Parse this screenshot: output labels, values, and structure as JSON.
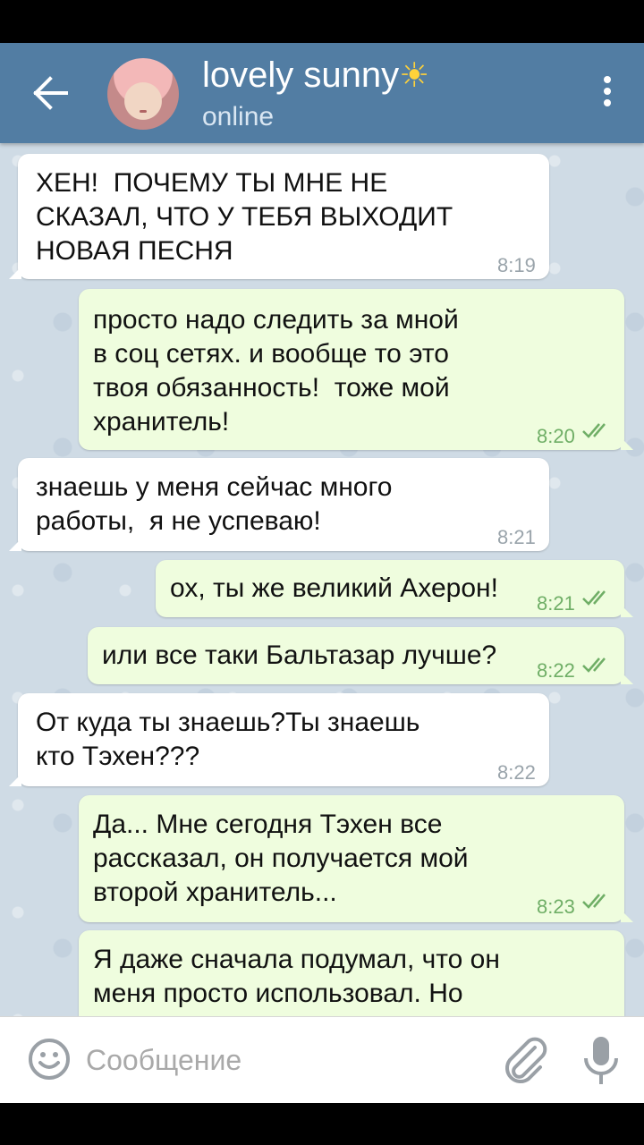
{
  "header": {
    "title": "lovely sunny",
    "title_emoji": "☀",
    "status": "online",
    "back_icon": "arrow-left-icon",
    "menu_icon": "more-vert-icon"
  },
  "messages": [
    {
      "dir": "in",
      "text": "ХЕН!  ПОЧЕМУ ТЫ МНЕ НЕ\nСКАЗАЛ, ЧТО У ТЕБЯ ВЫХОДИТ\nНОВАЯ ПЕСНЯ",
      "time": "8:19"
    },
    {
      "dir": "out",
      "text": "просто надо следить за мной\nв соц сетях. и вообще то это\nтвоя обязанность!  тоже мой\nхранитель!",
      "time": "8:20",
      "read": true
    },
    {
      "dir": "in",
      "text": "знаешь у меня сейчас много\nработы,  я не успеваю!",
      "time": "8:21"
    },
    {
      "dir": "out",
      "text": "ох, ты же великий Ахерон!",
      "time": "8:21",
      "read": true
    },
    {
      "dir": "out",
      "text": "или все таки Бальтазар лучше?",
      "time": "8:22",
      "read": true
    },
    {
      "dir": "in",
      "text": "От куда ты знаешь?Ты знаешь\nкто Тэхен???",
      "time": "8:22"
    },
    {
      "dir": "out",
      "text": "Да... Мне сегодня Тэхен все\nрассказал, он получается мой\nвторой хранитель...",
      "time": "8:23",
      "read": true
    },
    {
      "dir": "out",
      "text": "Я даже сначала подумал, что он\nменя просто использовал. Но",
      "time": "",
      "read": false
    }
  ],
  "input": {
    "placeholder": "Сообщение",
    "value": "",
    "emoji_icon": "emoji-icon",
    "attach_icon": "paperclip-icon",
    "mic_icon": "microphone-icon"
  },
  "colors": {
    "header": "#527da3",
    "chat_background": "#cfdbe5",
    "incoming_bubble": "#ffffff",
    "outgoing_bubble": "#effdde",
    "read_ticks": "#6fae66"
  }
}
